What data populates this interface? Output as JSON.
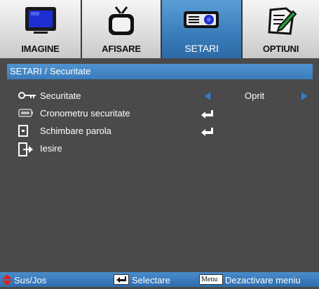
{
  "tabs": [
    {
      "label": "IMAGINE",
      "icon": "monitor-icon",
      "active": false
    },
    {
      "label": "AFISARE",
      "icon": "tv-icon",
      "active": false
    },
    {
      "label": "SETARI",
      "icon": "projector-icon",
      "active": true
    },
    {
      "label": "OPTIUNI",
      "icon": "options-icon",
      "active": false
    }
  ],
  "title": "SETARI / Securitate",
  "rows": [
    {
      "label": "Securitate",
      "icon": "key-icon",
      "value": "Oprit"
    },
    {
      "label": "Cronometru securitate",
      "icon": "timer-icon"
    },
    {
      "label": "Schimbare parola",
      "icon": "password-icon"
    },
    {
      "label": "Iesire",
      "icon": "exit-icon"
    }
  ],
  "footer": {
    "nav": "Sus/Jos",
    "select": "Selectare",
    "menu_key": "Menu",
    "exit": "Dezactivare meniu"
  },
  "colors": {
    "background": "#4a4a4a",
    "accent": "#3b7cbc",
    "arrow": "#2f7fd8"
  }
}
